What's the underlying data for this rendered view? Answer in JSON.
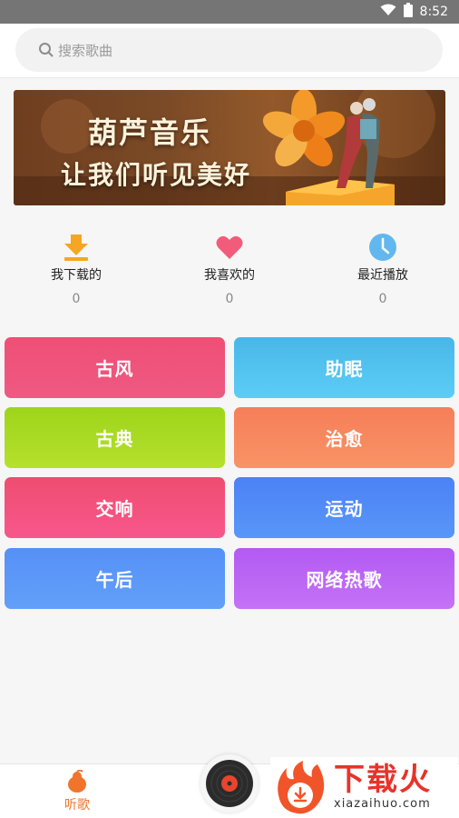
{
  "status_bar": {
    "time": "8:52"
  },
  "search": {
    "placeholder": "搜索歌曲"
  },
  "banner": {
    "title": "葫芦音乐",
    "subtitle": "让我们听见美好"
  },
  "quick_actions": [
    {
      "label": "我下载的",
      "count": "0",
      "icon": "download-icon"
    },
    {
      "label": "我喜欢的",
      "count": "0",
      "icon": "heart-icon"
    },
    {
      "label": "最近播放",
      "count": "0",
      "icon": "clock-icon"
    }
  ],
  "categories": [
    {
      "label": "古风",
      "color": "#ee4f7a"
    },
    {
      "label": "助眠",
      "color": "#4fbfee"
    },
    {
      "label": "古典",
      "color": "#a8d81e"
    },
    {
      "label": "治愈",
      "color": "#f7845c"
    },
    {
      "label": "交响",
      "color": "#f44e80"
    },
    {
      "label": "运动",
      "color": "#4a86f7"
    },
    {
      "label": "午后",
      "color": "#5a93f8"
    },
    {
      "label": "网络热歌",
      "color": "#b760f5"
    }
  ],
  "bottom_nav": {
    "listen_label": "听歌"
  },
  "watermark": {
    "title": "下载火",
    "url": "xiazaihuo.com"
  },
  "colors": {
    "accent": "#f0742c",
    "brand_red": "#e8332a"
  }
}
